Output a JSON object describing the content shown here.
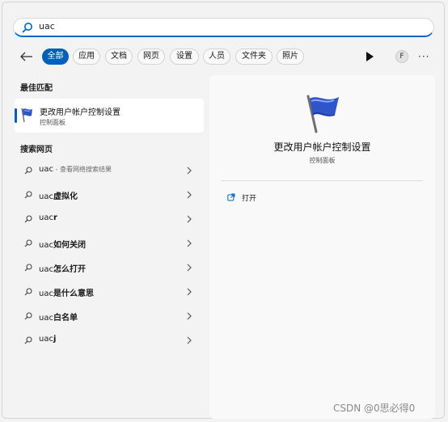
{
  "search": {
    "value": "uac"
  },
  "filters": [
    "全部",
    "应用",
    "文档",
    "网页",
    "设置",
    "人员",
    "文件夹",
    "照片"
  ],
  "account_initial": "F",
  "more_glyph": "···",
  "best_match": {
    "heading": "最佳匹配",
    "title": "更改用户帐户控制设置",
    "subtitle": "控制面板"
  },
  "web_search": {
    "heading": "搜索网页",
    "items": [
      {
        "prefix": "uac",
        "bold": "",
        "hint": " - 查看网络搜索结果"
      },
      {
        "prefix": "uac",
        "bold": "虚拟化",
        "hint": ""
      },
      {
        "prefix": "uac",
        "bold": "r",
        "hint": ""
      },
      {
        "prefix": "uac",
        "bold": "如何关闭",
        "hint": ""
      },
      {
        "prefix": "uac",
        "bold": "怎么打开",
        "hint": ""
      },
      {
        "prefix": "uac",
        "bold": "是什么意思",
        "hint": ""
      },
      {
        "prefix": "uac",
        "bold": "白名单",
        "hint": ""
      },
      {
        "prefix": "uac",
        "bold": "j",
        "hint": ""
      }
    ]
  },
  "detail": {
    "title": "更改用户帐户控制设置",
    "subtitle": "控制面板",
    "open_label": "打开"
  },
  "watermark": "CSDN @0思必得0",
  "colors": {
    "accent": "#005fb8",
    "flag": "#2f55c8"
  }
}
